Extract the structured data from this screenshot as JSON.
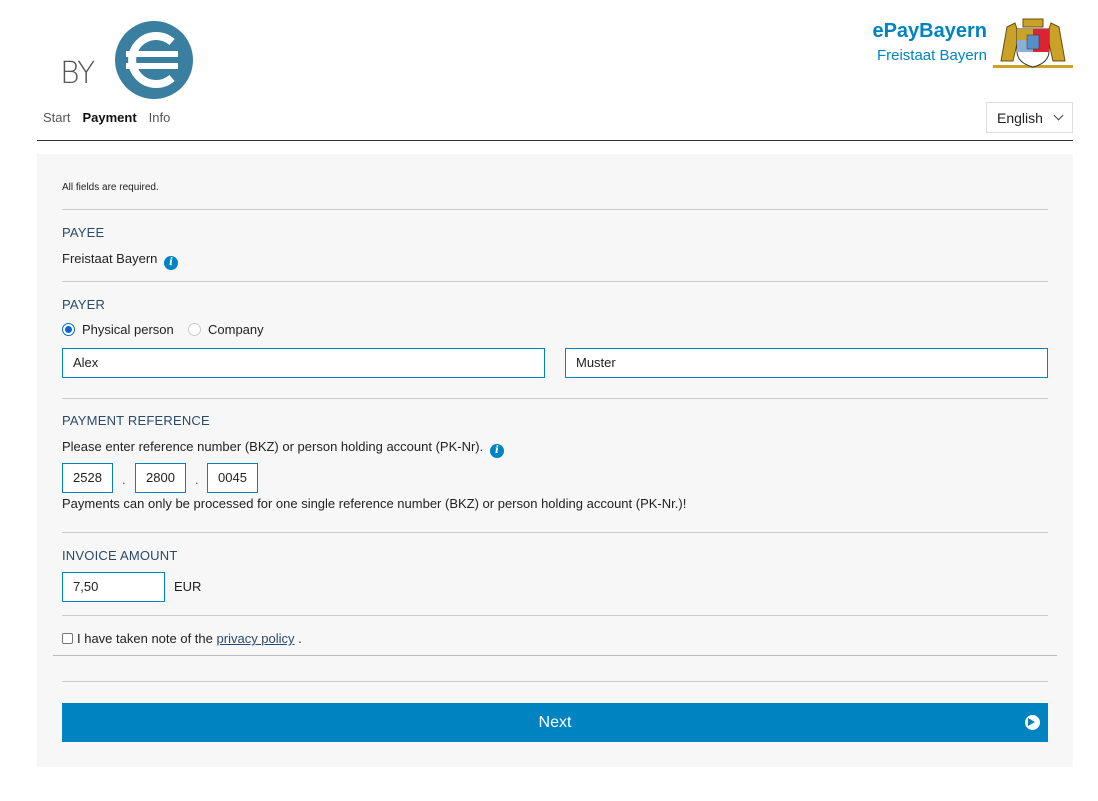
{
  "logo": {
    "text": "BY"
  },
  "nav": {
    "start": "Start",
    "payment": "Payment",
    "info": "Info"
  },
  "brand": {
    "title": "ePayBayern",
    "subtitle": "Freistaat Bayern"
  },
  "language": {
    "selected": "English"
  },
  "form": {
    "required_note": "All fields are required.",
    "payee": {
      "title": "PAYEE",
      "value": "Freistaat Bayern",
      "info_icon": "info-icon"
    },
    "payer": {
      "title": "PAYER",
      "options": [
        {
          "label": "Physical person",
          "checked": true
        },
        {
          "label": "Company",
          "checked": false
        }
      ],
      "first_name": "Alex",
      "last_name": "Muster"
    },
    "reference": {
      "title": "PAYMENT REFERENCE",
      "instruction": "Please enter reference number (BKZ) or person holding account (PK-Nr).",
      "part1": "2528",
      "part2": "2800",
      "part3": "0045",
      "separator": ".",
      "note": "Payments can only be processed for one single reference number (BKZ) or person holding account (PK-Nr.)!"
    },
    "amount": {
      "title": "INVOICE AMOUNT",
      "value": "7,50",
      "currency": "EUR"
    },
    "privacy": {
      "prefix": "I have taken note of the",
      "link": "privacy policy",
      "suffix": "."
    },
    "next_label": "Next"
  },
  "colors": {
    "accent": "#0083c1",
    "heading": "#2b4a6b",
    "panel": "#f7f7f7"
  }
}
